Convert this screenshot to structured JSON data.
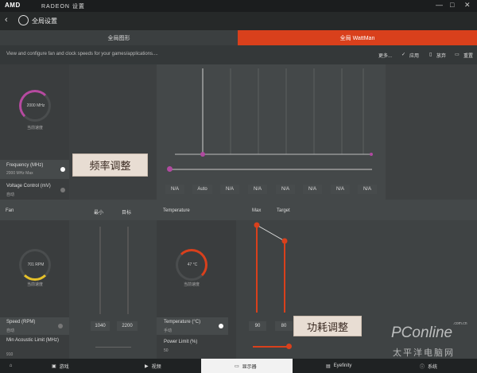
{
  "titlebar": {
    "brand": "AMD",
    "product": "RADEON 设置",
    "controls": {
      "min": "—",
      "max": "□",
      "close": "✕"
    }
  },
  "header": {
    "title": "全局设置"
  },
  "tabs": [
    {
      "label": "全局图形"
    },
    {
      "label": "全局 WattMan"
    }
  ],
  "toolbar": {
    "description": "View and configure fan and clock speeds for your games/applications....",
    "more": "更多...",
    "apply": "应用",
    "discard": "放弃",
    "reset": "重置"
  },
  "gpu": {
    "gauge_value": "2000 MHz",
    "gauge_label": "当前速度",
    "frequency_label": "Frequency (MHz)",
    "frequency_value": "2000 MHz Max",
    "voltage_label": "Voltage Control (mV)",
    "voltage_value": "自动",
    "state_chips": [
      "N/A",
      "Auto",
      "N/A",
      "N/A",
      "N/A",
      "N/A",
      "N/A",
      "N/A"
    ]
  },
  "callouts": {
    "frequency": "频率调整",
    "power": "功耗调整"
  },
  "fan": {
    "section_label": "Fan",
    "col_min": "最小",
    "col_target": "目标",
    "gauge_value": "701 RPM",
    "gauge_label": "当前速度",
    "speed_label": "Speed (RPM)",
    "speed_value": "自动",
    "min_acoustic_label": "Min Acoustic Limit (MHz)",
    "min_acoustic_value": "910",
    "min_value": "1040",
    "target_value": "2200"
  },
  "temperature": {
    "section_label": "Temperature",
    "col_max": "Max",
    "col_target": "Target",
    "gauge_value": "47 °C",
    "gauge_label": "当前速度",
    "temp_label": "Temperature (°C)",
    "temp_value": "手动",
    "power_label": "Power Limit (%)",
    "power_value": "50",
    "max_value": "90",
    "target_value": "80"
  },
  "bottomnav": [
    {
      "label": "游戏",
      "icon": "gamepad-icon"
    },
    {
      "label": "视频",
      "icon": "play-icon"
    },
    {
      "label": "显示器",
      "icon": "monitor-icon"
    },
    {
      "label": "Eyefinity",
      "icon": "eyefinity-icon"
    },
    {
      "label": "系统",
      "icon": "info-icon"
    }
  ],
  "watermark": {
    "brand": "PConline",
    "domain": ".com.cn",
    "cn": "太平洋电脑网"
  },
  "colors": {
    "accent": "#d9401c",
    "gauge_purple": "#b64aa0",
    "slider_purple": "#b04aa0",
    "fan_yellow": "#e6c12a"
  }
}
